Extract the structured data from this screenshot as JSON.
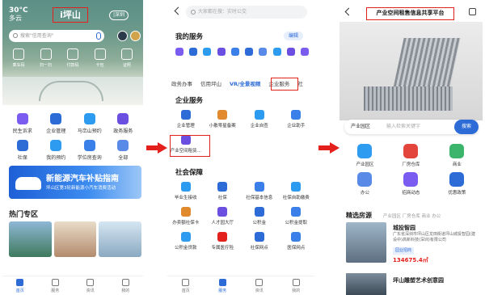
{
  "p1": {
    "weather_temp": "30°C",
    "weather_sub": "多云",
    "title": "i坪山",
    "switch_label": "|深圳",
    "search_placeholder": "搜索\"信用查询\"",
    "tiles": [
      {
        "label": "乘车码"
      },
      {
        "label": "扫一扫"
      },
      {
        "label": "付款码"
      },
      {
        "label": "卡包"
      },
      {
        "label": "证照"
      }
    ],
    "services": [
      {
        "label": "民生诉求",
        "color": "#7a5cf0"
      },
      {
        "label": "企业管理",
        "color": "#2d6bd6"
      },
      {
        "label": "马峦山预约",
        "color": "#2d9cf0"
      },
      {
        "label": "政务服务",
        "color": "#6b4fe0"
      },
      {
        "label": "社保",
        "color": "#2d6bd6"
      },
      {
        "label": "我的预约",
        "color": "#2d9cf0"
      },
      {
        "label": "学位房查询",
        "color": "#3b7fe8"
      },
      {
        "label": "全部",
        "color": "#5a8ae8"
      }
    ],
    "banner_title": "新能源汽车补贴指南",
    "banner_sub": "坪山区第3轮新能源小汽车消费活动",
    "section": "热门专区",
    "tabs": [
      {
        "label": "首页",
        "active": true
      },
      {
        "label": "服务",
        "active": false
      },
      {
        "label": "资讯",
        "active": false
      },
      {
        "label": "我的",
        "active": false
      }
    ]
  },
  "p2": {
    "search_placeholder": "大家都在搜：实时公交",
    "my_services": "我的服务",
    "edit": "编辑",
    "my_icons": [
      {
        "color": "#7a5cf0"
      },
      {
        "color": "#2d6bd6"
      },
      {
        "color": "#2d9cf0"
      },
      {
        "color": "#6b4fe0"
      },
      {
        "color": "#3b7fe8"
      },
      {
        "color": "#2d6bd6"
      },
      {
        "color": "#5a8ae8"
      },
      {
        "color": "#2d9cf0"
      },
      {
        "color": "#6b4fe0"
      },
      {
        "color": "#7a5cf0"
      }
    ],
    "tabs": [
      "政务办事",
      "信用坪山",
      "VR/全景视频",
      "企业服务",
      "社"
    ],
    "active_tab": "VR/全景视频",
    "enterprise_heading": "企业服务",
    "enterprise": [
      {
        "label": "企业管理",
        "color": "#2d6bd6"
      },
      {
        "label": "小散零星备案",
        "color": "#e08a2d"
      },
      {
        "label": "企业自查",
        "color": "#2d9cf0"
      },
      {
        "label": "企业助手",
        "color": "#3b7fe8"
      },
      {
        "label": "产业空间租赁...",
        "color": "#6b4fe0"
      }
    ],
    "social_heading": "社会保障",
    "social": [
      {
        "label": "毕业生接收",
        "color": "#2d9cf0"
      },
      {
        "label": "社保",
        "color": "#2d6bd6"
      },
      {
        "label": "社保基本信息",
        "color": "#3b7fe8"
      },
      {
        "label": "社保自助缴费",
        "color": "#2d9cf0"
      },
      {
        "label": "办卖额社保卡",
        "color": "#e08a2d"
      },
      {
        "label": "人才园大厅",
        "color": "#6b4fe0"
      },
      {
        "label": "公积金",
        "color": "#2d6bd6"
      },
      {
        "label": "公积金提取",
        "color": "#3b7fe8"
      },
      {
        "label": "公积金贷款",
        "color": "#2d9cf0"
      },
      {
        "label": "专属医疗险",
        "color": "#e3201b"
      },
      {
        "label": "社保网点",
        "color": "#2d6bd6"
      },
      {
        "label": "医保网点",
        "color": "#3b7fe8"
      }
    ],
    "tabbar": [
      {
        "label": "首页",
        "active": false
      },
      {
        "label": "服务",
        "active": true
      },
      {
        "label": "资讯",
        "active": false
      },
      {
        "label": "我的",
        "active": false
      }
    ]
  },
  "p3": {
    "title": "产业空间租售信息共享平台",
    "search_zone": "产业园区",
    "search_placeholder": "输入检索关键字",
    "search_button": "搜索",
    "categories": [
      {
        "label": "产业园区",
        "color": "#2d9cf0"
      },
      {
        "label": "厂房仓库",
        "color": "#e3443b"
      },
      {
        "label": "商业",
        "color": "#3bb56b"
      },
      {
        "label": "办公",
        "color": "#5a8ae8"
      },
      {
        "label": "招商动态",
        "color": "#7a5cf0"
      },
      {
        "label": "优惠政策",
        "color": "#2d6bd6"
      }
    ],
    "selected_heading": "精选房源",
    "selected_tabs": "产业园区  厂房仓库  商业  办公",
    "card1_name": "城投智园",
    "card1_address": "广东省深圳市坪山区龙田街道坪山城投智园(建设中)高新科技(深圳)有限公司",
    "card1_tag": "园业招商",
    "card1_price": "134675.4㎡",
    "card2_name": "坪山雕塑艺术创意园"
  }
}
